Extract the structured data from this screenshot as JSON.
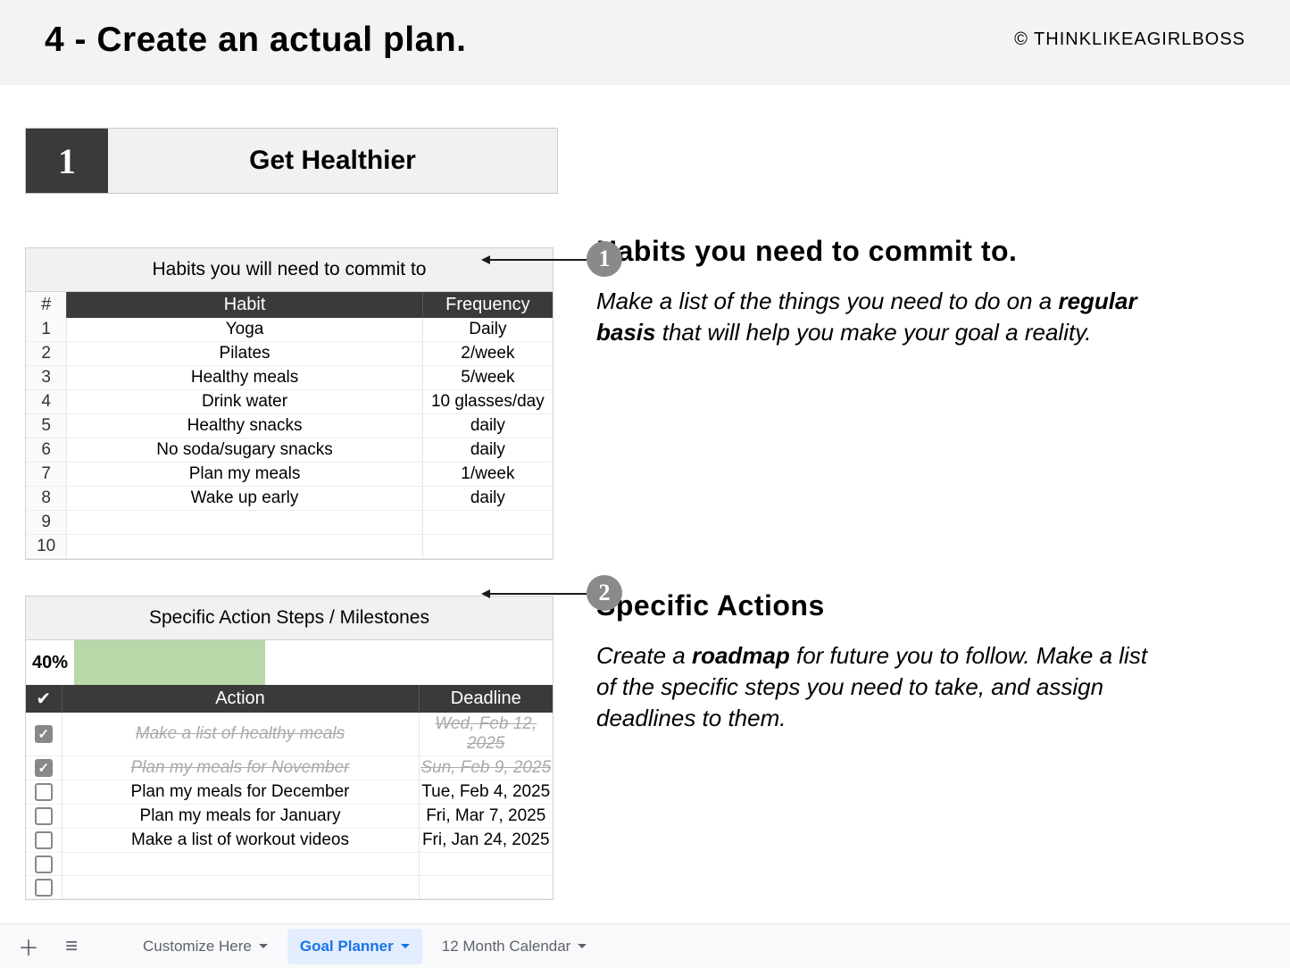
{
  "header": {
    "title": "4 - Create an actual plan.",
    "credit": "© THINKLIKEAGIRLBOSS"
  },
  "goal": {
    "number": "1",
    "title": "Get Healthier"
  },
  "habits_table": {
    "caption": "Habits you will need to commit to",
    "headers": {
      "num": "#",
      "habit": "Habit",
      "freq": "Frequency"
    },
    "rows": [
      {
        "n": "1",
        "habit": "Yoga",
        "freq": "Daily"
      },
      {
        "n": "2",
        "habit": "Pilates",
        "freq": "2/week"
      },
      {
        "n": "3",
        "habit": "Healthy meals",
        "freq": "5/week"
      },
      {
        "n": "4",
        "habit": "Drink water",
        "freq": "10 glasses/day"
      },
      {
        "n": "5",
        "habit": "Healthy snacks",
        "freq": "daily"
      },
      {
        "n": "6",
        "habit": "No soda/sugary snacks",
        "freq": "daily"
      },
      {
        "n": "7",
        "habit": "Plan my meals",
        "freq": "1/week"
      },
      {
        "n": "8",
        "habit": "Wake up early",
        "freq": "daily"
      },
      {
        "n": "9",
        "habit": "",
        "freq": ""
      },
      {
        "n": "10",
        "habit": "",
        "freq": ""
      }
    ]
  },
  "actions_table": {
    "caption": "Specific Action Steps / Milestones",
    "progress_label": "40%",
    "progress_pct": 40,
    "headers": {
      "chk": "✔",
      "action": "Action",
      "deadline": "Deadline"
    },
    "rows": [
      {
        "done": true,
        "action": "Make a list of healthy meals",
        "deadline": "Wed, Feb 12, 2025"
      },
      {
        "done": true,
        "action": "Plan my meals for November",
        "deadline": "Sun, Feb 9, 2025"
      },
      {
        "done": false,
        "action": "Plan my meals for December",
        "deadline": "Tue, Feb 4, 2025"
      },
      {
        "done": false,
        "action": "Plan my meals for January",
        "deadline": "Fri, Mar 7, 2025"
      },
      {
        "done": false,
        "action": "Make a list of workout videos",
        "deadline": "Fri, Jan 24, 2025"
      },
      {
        "done": false,
        "action": "",
        "deadline": ""
      },
      {
        "done": false,
        "action": "",
        "deadline": ""
      }
    ]
  },
  "annotations": {
    "b1": "1",
    "b2": "2",
    "h1": "Habits you need to commit to.",
    "p1a": "Make a list of the things you need to do on a ",
    "p1b": "regular basis",
    "p1c": " that will help you make your goal a reality.",
    "h2": "Specific Actions",
    "p2a": "Create a ",
    "p2b": "roadmap",
    "p2c": " for future you to follow. Make a list of the specific steps you need to take, and assign deadlines to them."
  },
  "tabs": {
    "t1": "Customize Here",
    "t2": "Goal Planner",
    "t3": "12 Month Calendar"
  }
}
